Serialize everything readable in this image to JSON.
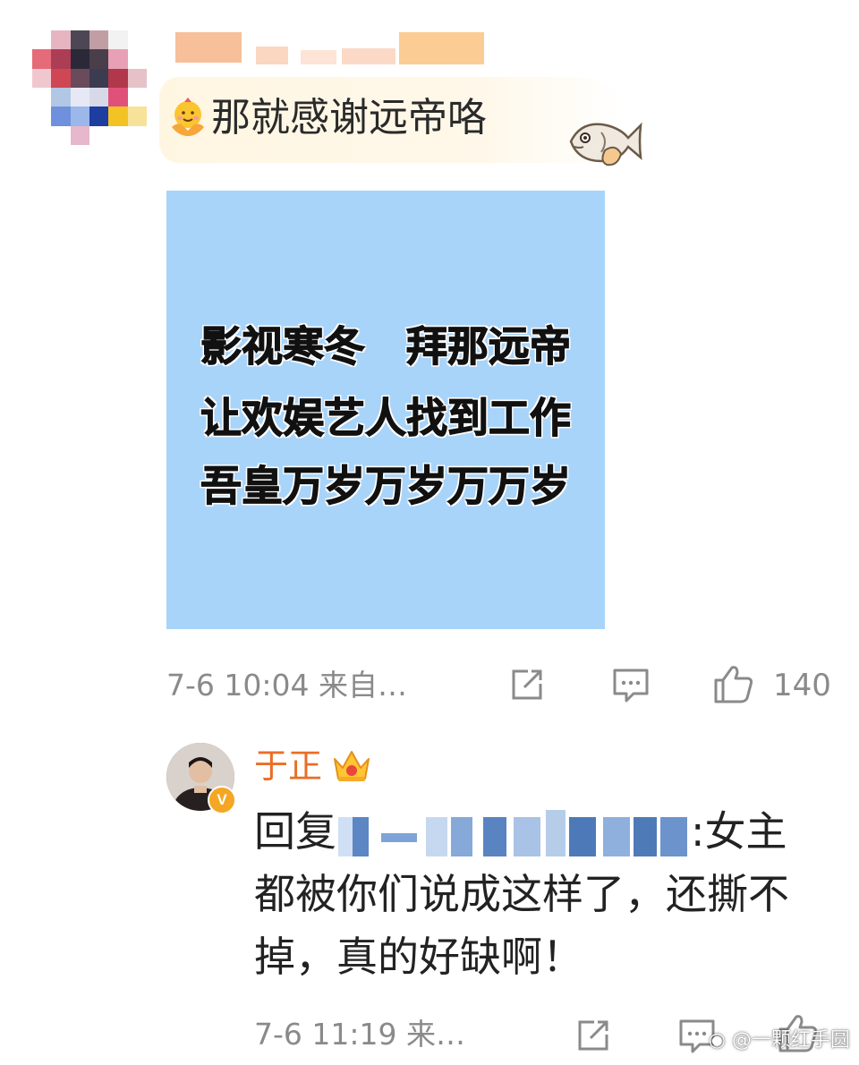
{
  "comment": {
    "text": "那就感谢远帝咯",
    "emoji_icon": "hug-emoji-icon",
    "sticker_icon": "fish-sticker-icon",
    "image_lines": [
      "影视寒冬　拜那远帝",
      "让欢娱艺人找到工作",
      "吾皇万岁万岁万万岁"
    ],
    "image_bg": "#a9d4f9",
    "time": "7-6 10:04",
    "source": "来自…",
    "like_count": "140"
  },
  "reply": {
    "author": "于正",
    "author_color": "#e96e26",
    "badge": "V",
    "prefix": "回复",
    "body": ":女主都被你们说成这样了，还撕不掉，真的好缺啊！",
    "time": "7-6 11:19",
    "source": "来…"
  },
  "watermark": "@一颗红手圆"
}
